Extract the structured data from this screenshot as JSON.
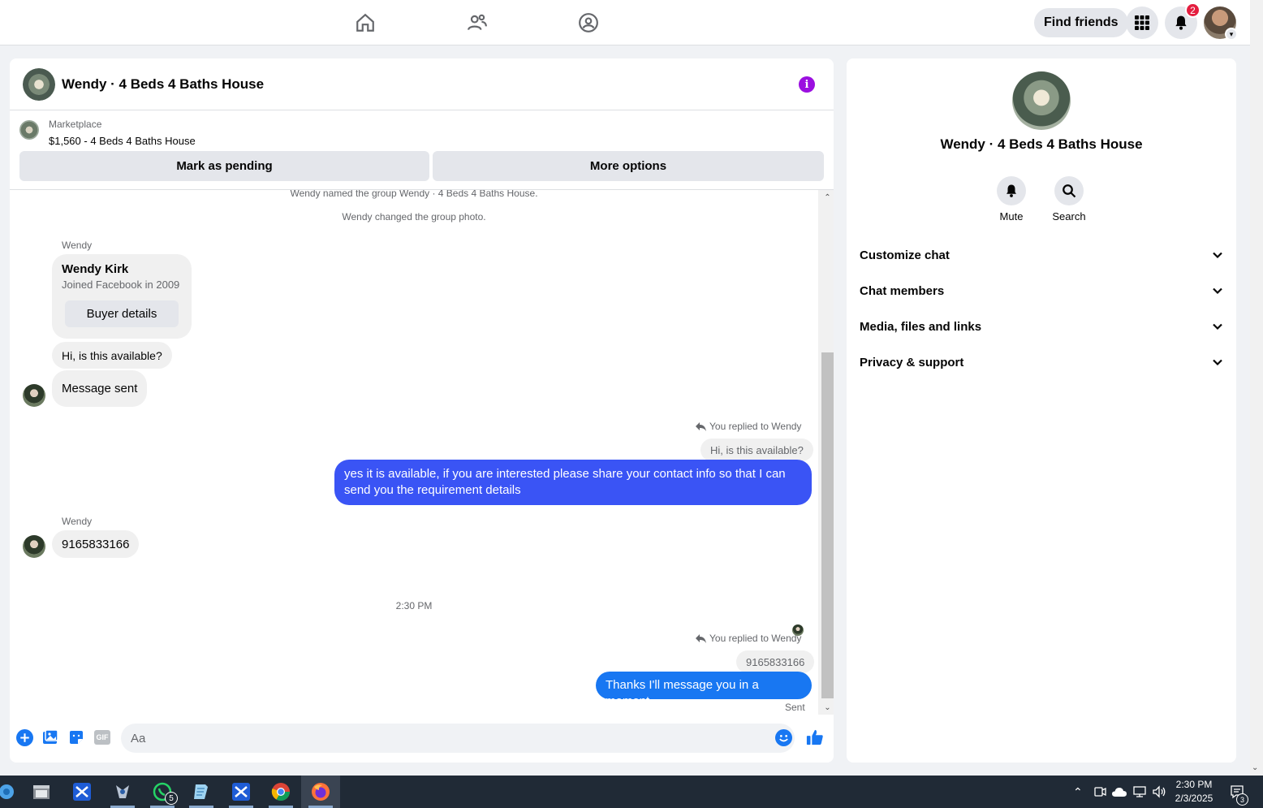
{
  "topnav": {
    "find_friends_label": "Find friends",
    "notification_count": "2",
    "icons": [
      "home-icon",
      "friends-icon",
      "groups-icon",
      "menu-grid-icon",
      "bell-icon"
    ]
  },
  "chat": {
    "title": "Wendy · 4 Beds 4 Baths House",
    "marketplace": {
      "label": "Marketplace",
      "price_title": "$1,560 - 4 Beds 4 Baths House",
      "mark_pending_label": "Mark as pending",
      "more_options_label": "More options"
    },
    "system_messages": [
      "Wendy named the group Wendy · 4 Beds 4 Baths House.",
      "Wendy changed the group photo."
    ],
    "sender_name": "Wendy",
    "buyer_card": {
      "name": "Wendy Kirk",
      "joined": "Joined Facebook in 2009",
      "button_label": "Buyer details"
    },
    "incoming_1": "Hi, is this available?",
    "incoming_2": "Message sent",
    "reply_1": {
      "label": "You replied to Wendy",
      "quoted": "Hi, is this available?",
      "text": "yes it is available, if you are interested please share your contact info so that I can send you the requirement details"
    },
    "sender_name_2": "Wendy",
    "incoming_3": "9165833166",
    "timestamp": "2:30 PM",
    "reply_2": {
      "label": "You replied to Wendy",
      "quoted": "9165833166",
      "text": "Thanks I'll message you in a moment"
    },
    "status": "Sent",
    "composer": {
      "placeholder": "Aa",
      "gif_label": "GIF"
    }
  },
  "side": {
    "name": "Wendy · 4 Beds 4 Baths House",
    "mute_label": "Mute",
    "search_label": "Search",
    "sections": [
      "Customize chat",
      "Chat members",
      "Media, files and links",
      "Privacy & support"
    ]
  },
  "taskbar": {
    "clock_time": "2:30 PM",
    "clock_date": "2/3/2025",
    "whatsapp_badge": "5",
    "notification_badge": "3"
  },
  "colors": {
    "accent": "#1877f2",
    "outgoing_bubble": "#3a54f5",
    "info_icon": "#9b0fe0",
    "badge": "#e41e3f"
  }
}
